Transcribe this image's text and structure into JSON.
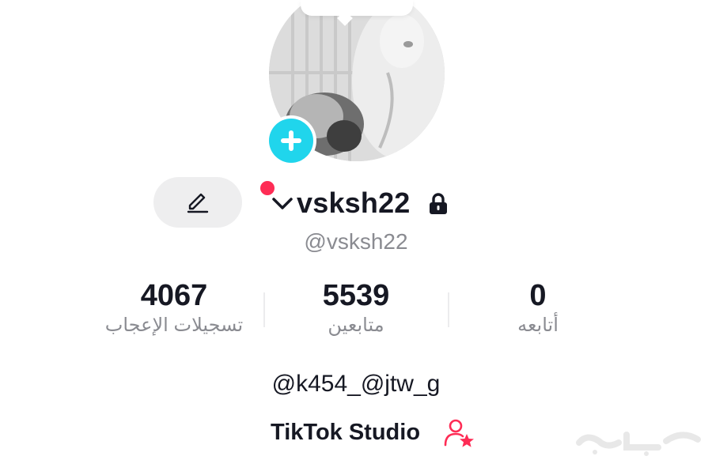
{
  "profile": {
    "display_name": "vsksh22",
    "handle": "@vsksh22",
    "bio": "@k454_@jtw_g",
    "studio_label": "TikTok Studio"
  },
  "stats": [
    {
      "value": "4067",
      "label": "تسجيلات الإعجاب"
    },
    {
      "value": "5539",
      "label": "متابعين"
    },
    {
      "value": "0",
      "label": "أتابعه"
    }
  ],
  "icons": {
    "add": "plus-icon",
    "edit": "pencil-icon",
    "account_switch": "chevron-down-icon",
    "private": "lock-icon",
    "studio": "creator-star-icon"
  },
  "colors": {
    "accent_cyan": "#20d5ec",
    "notification_red": "#fe2c55",
    "studio_pink": "#fe2c55",
    "muted_text": "#8a8b91"
  }
}
